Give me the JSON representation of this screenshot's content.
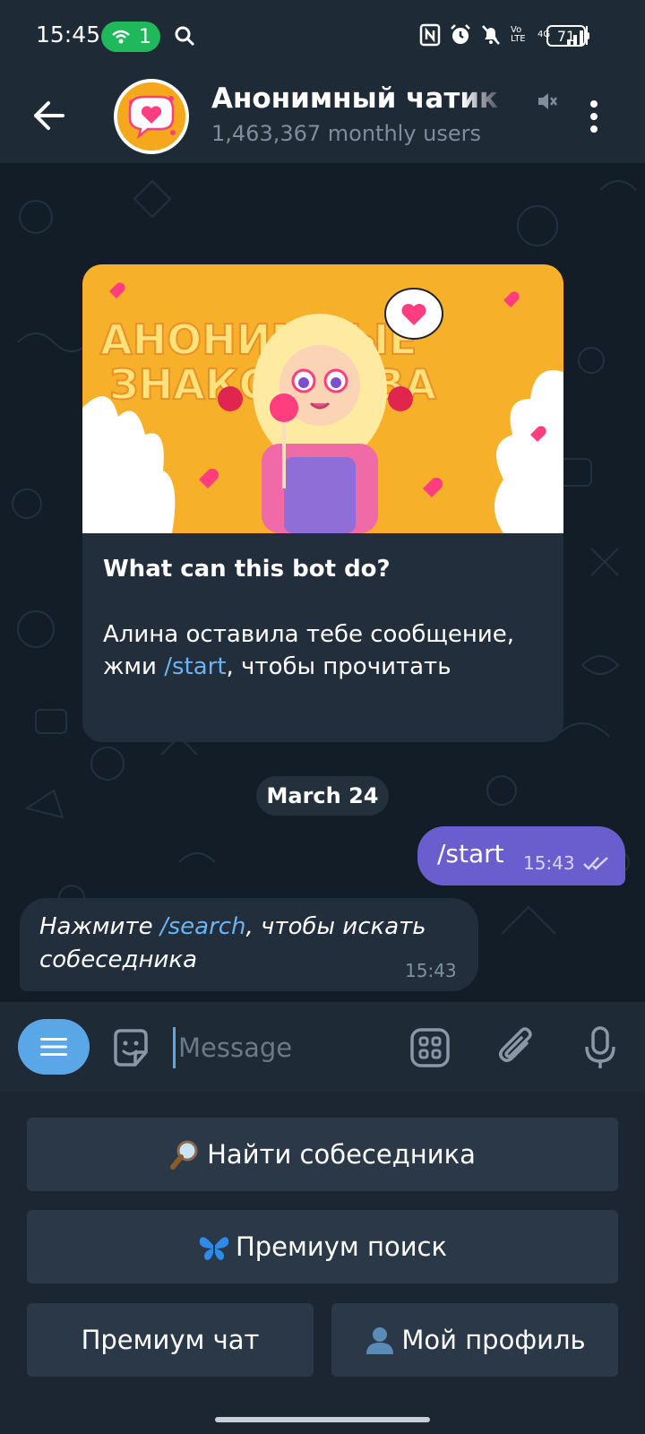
{
  "status_bar": {
    "time": "15:45",
    "hotspot_count": "1",
    "net_label_top": "4G",
    "net_label_bottom": "LTE",
    "battery": "71",
    "icons": [
      "hotspot-icon",
      "search-icon",
      "nfc-icon",
      "alarm-icon",
      "mute-icon",
      "volte-icon",
      "signal-icon",
      "battery-icon"
    ]
  },
  "header": {
    "title": "Анонимный чатик | Ch",
    "subtitle": "1,463,367 monthly users",
    "icons": [
      "back-arrow-icon",
      "avatar",
      "muted-icon",
      "more-vertical-icon"
    ]
  },
  "chat": {
    "bot_card": {
      "image_text": "Анонимные знакомства",
      "title": "What can this bot do?",
      "desc_before": "Алина оставила тебе сообщение, жми ",
      "desc_link": "/start",
      "desc_after": ", чтобы прочитать"
    },
    "date_label": "March 24",
    "outgoing": {
      "text": "/start",
      "time": "15:43"
    },
    "incoming": {
      "text_before": "Нажмите ",
      "text_link": "/search",
      "text_after": ", чтобы искать собеседника",
      "time": "15:43"
    }
  },
  "input_bar": {
    "placeholder": "Message",
    "icons": [
      "bot-menu-icon",
      "sticker-icon",
      "commands-icon",
      "attach-icon",
      "mic-icon"
    ]
  },
  "keyboard": {
    "buttons": [
      {
        "label": "Найти собеседника",
        "icon": "magnifier-icon"
      },
      {
        "label": "Премиум поиск",
        "icon": "butterfly-icon"
      },
      {
        "label": "Премиум чат"
      },
      {
        "label": "Мой профиль",
        "icon": "person-icon"
      }
    ]
  },
  "colors": {
    "background": "#131d27",
    "header": "#1f2a37",
    "bubble_in": "#222e3b",
    "bubble_out": "#6a5ecf",
    "link": "#6ab4f3",
    "accent": "#5aa7e8",
    "hotspot": "#1fb85a"
  }
}
